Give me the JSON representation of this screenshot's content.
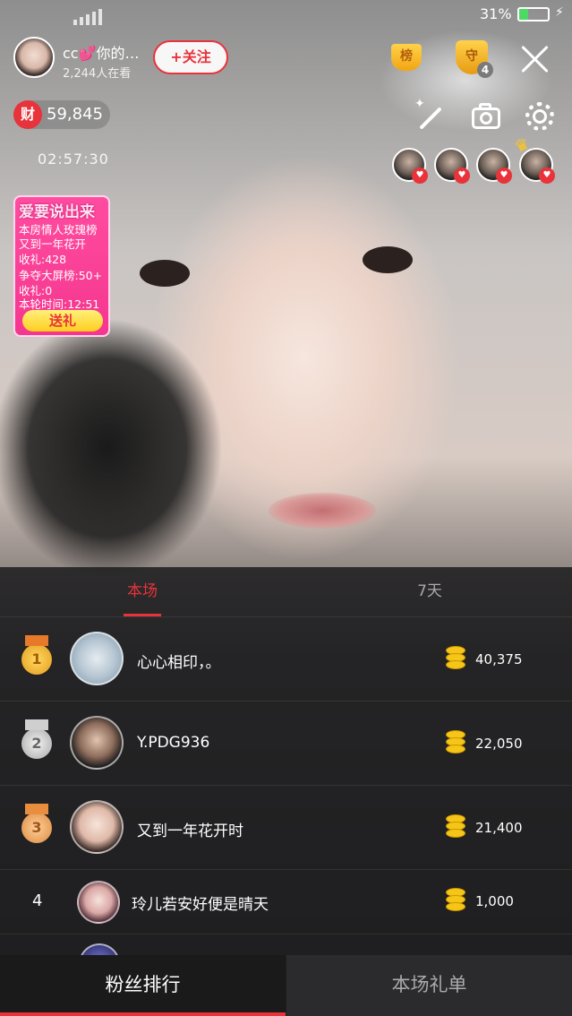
{
  "status_bar": {
    "battery_pct": "31%"
  },
  "host": {
    "name": "cc💕你的…",
    "viewers": "2,244人在看",
    "follow_label": "+关注",
    "wealth_label": "财",
    "wealth_value": "59,845",
    "timer": "02:57:30"
  },
  "top_icons": {
    "rank_label": "榜",
    "guard_label": "守",
    "guard_count": "4"
  },
  "promo": {
    "title": "爱要说出来",
    "line1": "本房情人玫瑰榜",
    "line2": "又到一年花开",
    "line3": "收礼:428",
    "line4": "争夺大屏榜:50+",
    "line5": "收礼:0",
    "line6": "本轮时间:12:51",
    "button": "送礼"
  },
  "panel": {
    "tabs": [
      {
        "label": "本场",
        "active": true
      },
      {
        "label": "7天",
        "active": false
      }
    ],
    "rows": [
      {
        "rank": "1",
        "name": "心心相印，。",
        "value": "40,375"
      },
      {
        "rank": "2",
        "name": "Y.PDG936",
        "value": "22,050"
      },
      {
        "rank": "3",
        "name": "又到一年花开时",
        "value": "21,400"
      },
      {
        "rank": "4",
        "name": "玲儿若安好便是晴天",
        "value": "1,000"
      }
    ]
  },
  "bottom_tabs": {
    "left": "粉丝排行",
    "right": "本场礼单"
  },
  "colors": {
    "accent": "#e8333b",
    "promo": "#f5368f",
    "coin": "#f5c517"
  }
}
